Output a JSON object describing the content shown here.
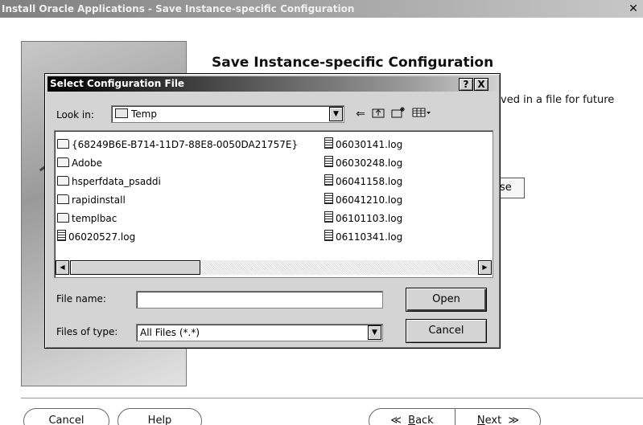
{
  "window": {
    "title": "Install Oracle Applications - Save Instance-specific Configuration",
    "close_glyph": "✕"
  },
  "wizard": {
    "heading": "Save Instance-specific Configuration",
    "text_fragment": "ved in a file for future",
    "browse_fragment": "se",
    "buttons": {
      "cancel": "Cancel",
      "help": "Help",
      "back_arrow": "≪",
      "back_underlined": "B",
      "back_rest": "ack",
      "next_underlined": "N",
      "next_rest": "ext",
      "next_arrow": "≫"
    }
  },
  "dialog": {
    "title": "Select Configuration File",
    "help_glyph": "?",
    "close_glyph": "X",
    "look_in_label": "Look in:",
    "look_in_value": "Temp",
    "toolbar_icons": [
      "back-arrow-icon",
      "up-folder-icon",
      "new-folder-icon",
      "view-menu-icon"
    ],
    "files_col1": [
      {
        "name": "{68249B6E-B714-11D7-88E8-0050DA21757E}",
        "icon": "folder-icon"
      },
      {
        "name": "Adobe",
        "icon": "folder-icon"
      },
      {
        "name": "hsperfdata_psaddi",
        "icon": "folder-icon"
      },
      {
        "name": "rapidinstall",
        "icon": "folder-icon"
      },
      {
        "name": "templbac",
        "icon": "folder-icon"
      },
      {
        "name": "06020527.log",
        "icon": "log-file-icon"
      }
    ],
    "files_col2": [
      {
        "name": "06030141.log",
        "icon": "log-file-icon"
      },
      {
        "name": "06030248.log",
        "icon": "log-file-icon"
      },
      {
        "name": "06041158.log",
        "icon": "log-file-icon"
      },
      {
        "name": "06041210.log",
        "icon": "log-file-icon"
      },
      {
        "name": "06101103.log",
        "icon": "log-file-icon"
      },
      {
        "name": "06110341.log",
        "icon": "log-file-icon"
      }
    ],
    "file_name_label": "File name:",
    "file_name_value": "",
    "files_of_type_label": "Files of type:",
    "files_of_type_value": "All Files (*.*)",
    "open_button": "Open",
    "cancel_button": "Cancel"
  }
}
